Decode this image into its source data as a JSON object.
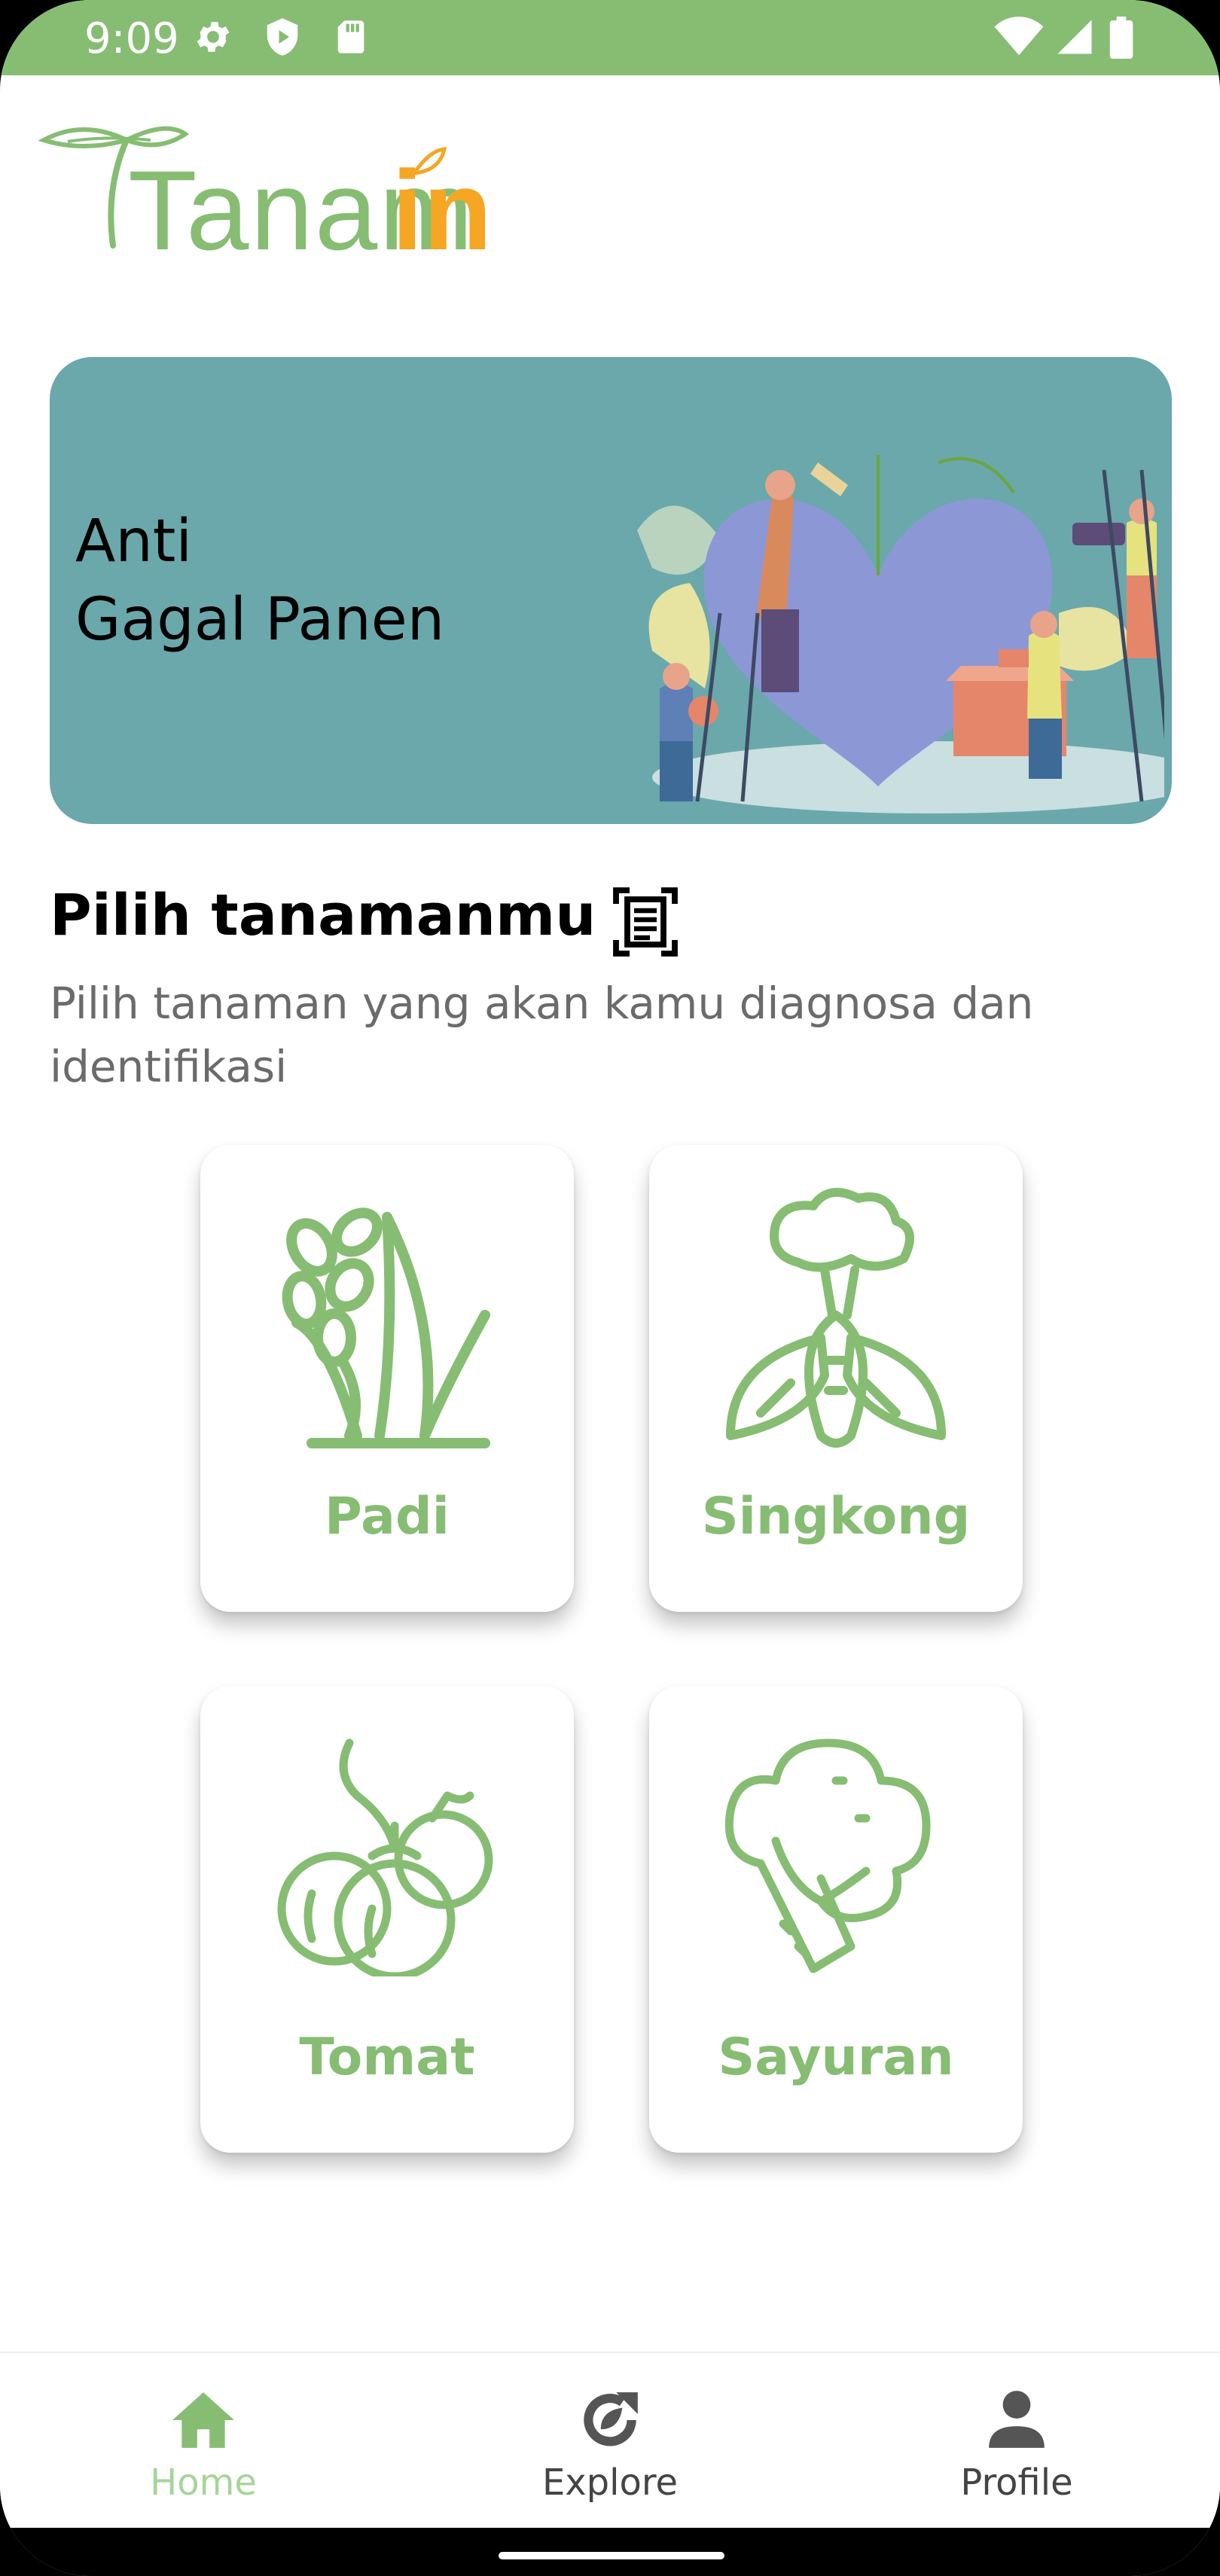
{
  "status_bar": {
    "time": "9:09",
    "icons_left": [
      "gear-icon",
      "shield-play-icon",
      "sd-card-icon"
    ],
    "icons_right": [
      "wifi-icon",
      "signal-icon",
      "battery-icon"
    ],
    "color": "#86bd73"
  },
  "logo": {
    "text_main": "Tanam",
    "text_accent": "in"
  },
  "banner": {
    "line1": "Anti",
    "line2": "Gagal Panen",
    "bg_color": "#6aa8ab"
  },
  "section": {
    "title": "Pilih tanamanmu",
    "subtitle": "Pilih tanaman yang akan kamu diagnosa dan identifikasi"
  },
  "plants": [
    {
      "label": "Padi",
      "icon": "rice-plant-icon"
    },
    {
      "label": "Singkong",
      "icon": "cassava-icon"
    },
    {
      "label": "Tomat",
      "icon": "tomato-icon"
    },
    {
      "label": "Sayuran",
      "icon": "broccoli-icon"
    }
  ],
  "nav": {
    "items": [
      {
        "label": "Home",
        "icon": "home-icon",
        "active": true
      },
      {
        "label": "Explore",
        "icon": "explore-icon",
        "active": false
      },
      {
        "label": "Profile",
        "icon": "person-icon",
        "active": false
      }
    ]
  },
  "colors": {
    "brand_green": "#86bd73",
    "brand_orange": "#f5a623",
    "nav_active": "#a6d59a"
  }
}
